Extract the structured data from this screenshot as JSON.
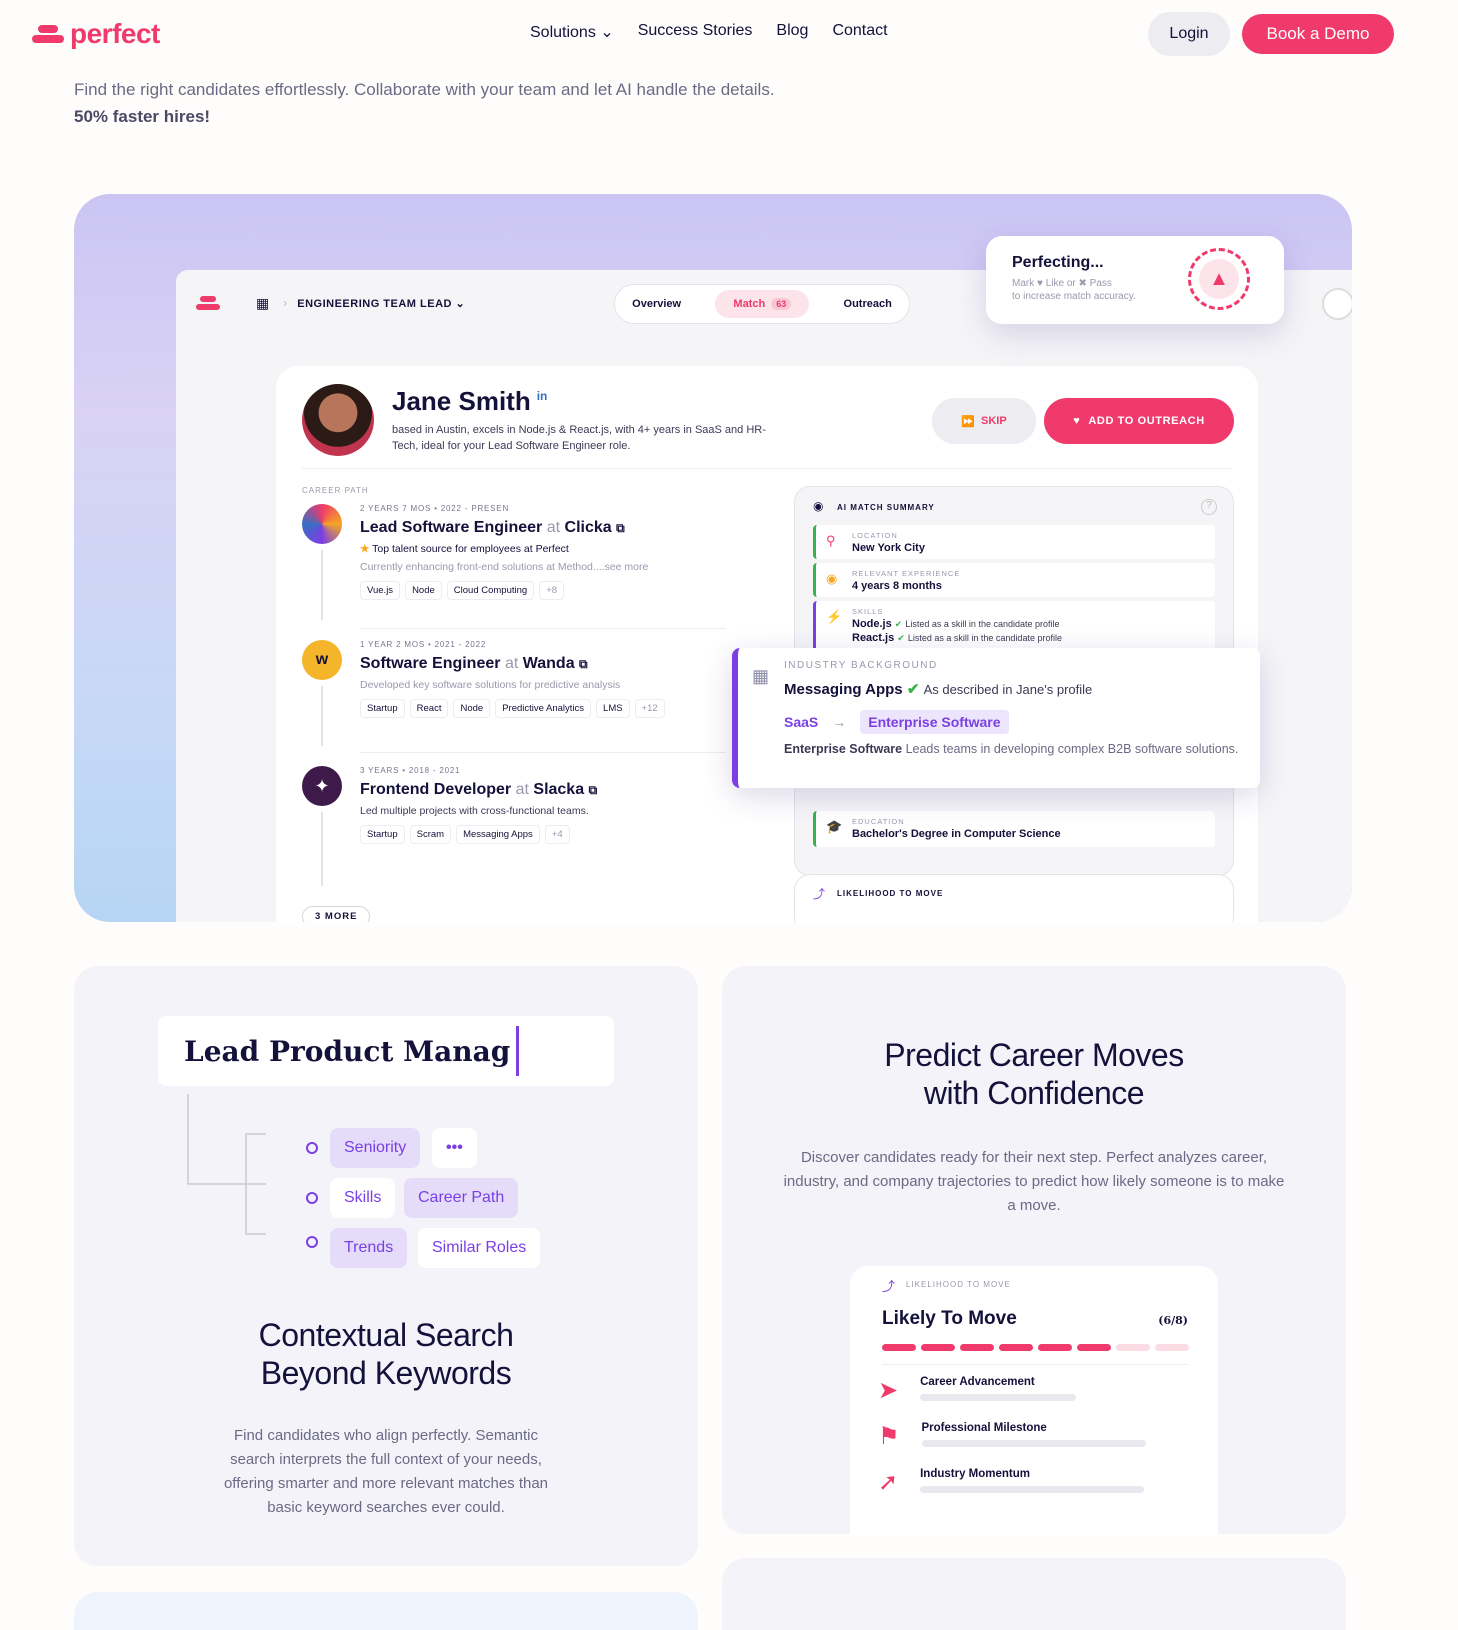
{
  "nav": {
    "logo": "perfect",
    "links": [
      "Solutions",
      "Success Stories",
      "Blog",
      "Contact"
    ],
    "login": "Login",
    "book_demo": "Book a Demo"
  },
  "intro": {
    "text": "Find the right candidates effortlessly. Collaborate with your team and let AI handle the details.",
    "highlight": "50% faster hires!"
  },
  "app": {
    "breadcrumb": "ENGINEERING TEAM LEAD",
    "tabs": {
      "overview": "Overview",
      "match": "Match",
      "match_count": "63",
      "outreach": "Outreach"
    },
    "perfecting": {
      "title": "Perfecting...",
      "line1": "Mark ♥ Like or ✖ Pass",
      "line2": "to increase match accuracy."
    },
    "candidate": {
      "name": "Jane Smith",
      "linkedin": "in",
      "blurb": "based in Austin, excels in Node.js & React.js, with 4+ years in SaaS and HR-Tech, ideal for your Lead Software Engineer role.",
      "skip": "SKIP",
      "add": "ADD TO OUTREACH"
    },
    "career_label": "CAREER PATH",
    "jobs": [
      {
        "meta": "2 YEARS 7 MOS • 2022 - PRESEN",
        "title": "Lead Software Engineer",
        "at": "at",
        "company": "Clicka",
        "note": "Top talent source for employees at Perfect",
        "desc": "Currently enhancing front-end solutions at Method....see more",
        "tags": [
          "Vue.js",
          "Node",
          "Cloud Computing",
          "+8"
        ],
        "color": "#7b3fe4"
      },
      {
        "meta": "1 YEAR 2 MOS • 2021 - 2022",
        "title": "Software Engineer",
        "at": "at",
        "company": "Wanda",
        "desc": "Developed key software solutions for predictive analysis",
        "tags": [
          "Startup",
          "React",
          "Node",
          "Predictive Analytics",
          "LMS",
          "+12"
        ],
        "color": "#f4b52a"
      },
      {
        "meta": "3 YEARS • 2018 - 2021",
        "title": "Frontend Developer",
        "at": "at",
        "company": "Slacka",
        "desc": "Led multiple projects with cross-functional teams.",
        "tags": [
          "Startup",
          "Scram",
          "Messaging Apps",
          "+4"
        ],
        "color": "#3d1a4a"
      }
    ],
    "more": "3 MORE",
    "summary": {
      "title": "AI MATCH SUMMARY",
      "location_label": "LOCATION",
      "location": "New York City",
      "experience_label": "RELEVANT EXPERIENCE",
      "experience": "4 years 8 months",
      "skills_label": "SKILLS",
      "skill1": "Node.js",
      "skill2": "React.js",
      "skill_note": "Listed as a skill in the candidate profile",
      "education_label": "EDUCATION",
      "education": "Bachelor's Degree in Computer Science",
      "likelihood_label": "LIKELIHOOD TO MOVE"
    },
    "industry": {
      "label": "INDUSTRY BACKGROUND",
      "title": "Messaging Apps",
      "desc_note": "As described in Jane's profile",
      "from": "SaaS",
      "to": "Enterprise Software",
      "body_bold": "Enterprise Software",
      "body": "Leads teams in developing complex B2B software solutions."
    }
  },
  "feature_search": {
    "query": "Lead Product Manag",
    "chips": [
      "Seniority",
      "•••",
      "Skills",
      "Career Path",
      "Trends",
      "Similar Roles"
    ],
    "heading1": "Contextual Search",
    "heading2": "Beyond Keywords",
    "body": "Find candidates who align perfectly. Semantic search interprets the full context of your needs, offering smarter and more relevant matches than basic keyword searches ever could."
  },
  "feature_predict": {
    "heading1": "Predict Career Moves",
    "heading2": "with Confidence",
    "body": "Discover candidates ready for their next step. Perfect analyzes career, industry, and company trajectories to predict how likely someone is to make a move.",
    "widget": {
      "label": "LIKELIHOOD TO MOVE",
      "title": "Likely To Move",
      "score": "(6/8)",
      "score_value": 6,
      "score_max": 8,
      "rows": [
        "Career Advancement",
        "Professional Milestone",
        "Industry Momentum"
      ]
    }
  },
  "colors": {
    "brand": "#ef3a6b",
    "accent": "#7b3fe4",
    "green": "#37b24d"
  }
}
